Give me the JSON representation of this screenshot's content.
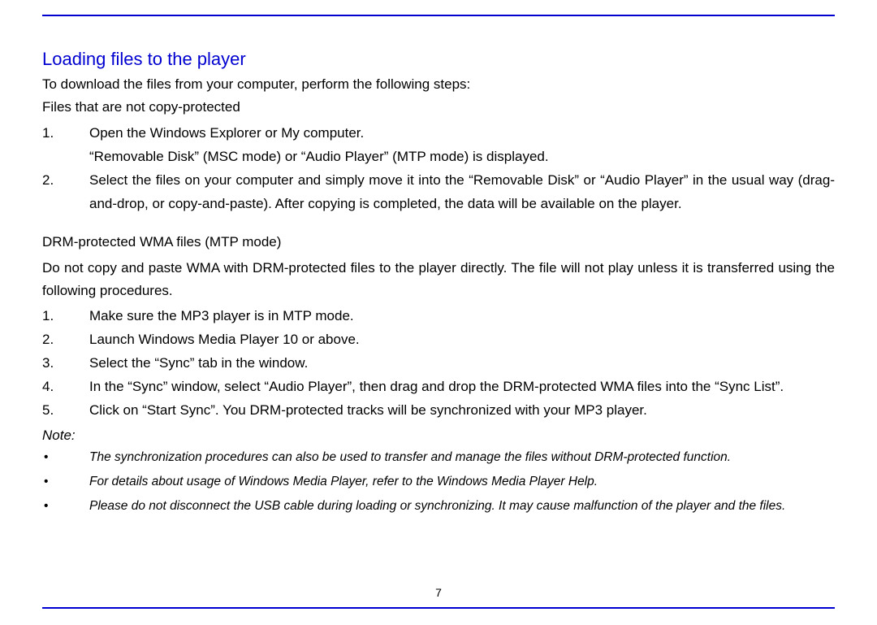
{
  "heading": "Loading files to the player",
  "intro": "To download the files from your computer, perform the following steps:",
  "sectionA": {
    "title": "Files that are not copy-protected",
    "items": [
      {
        "num": "1.",
        "text": "Open the Windows Explorer or My computer."
      },
      {
        "num": "",
        "text": "“Removable Disk” (MSC mode) or “Audio Player” (MTP mode) is displayed."
      },
      {
        "num": "2.",
        "text": "Select the files on your computer and simply move it into the “Removable Disk” or “Audio Player” in the usual way (drag-and-drop, or copy-and-paste). After copying is completed, the data will be available on the player."
      }
    ]
  },
  "sectionB": {
    "title": "DRM-protected WMA files (MTP mode)",
    "para": "Do not copy and paste WMA with DRM-protected files to the player directly. The file will not play unless it is transferred using the following procedures.",
    "items": [
      {
        "num": "1.",
        "text": "Make sure the MP3 player is in MTP mode."
      },
      {
        "num": "2.",
        "text": "Launch Windows Media Player 10 or above."
      },
      {
        "num": "3.",
        "text": "Select the “Sync” tab in the window."
      },
      {
        "num": "4.",
        "text": "In the “Sync” window, select “Audio Player”, then drag and drop the DRM-protected WMA files into the “Sync List”."
      },
      {
        "num": "5.",
        "text": "Click on “Start Sync”. You DRM-protected tracks will be synchronized with your MP3 player."
      }
    ]
  },
  "noteLabel": "Note:",
  "notes": [
    "The synchronization procedures can also be used to transfer and manage the files without DRM-protected function.",
    "For details about usage of Windows Media Player, refer to the Windows Media Player Help.",
    "Please do not disconnect the USB cable during loading or synchronizing. It may cause malfunction of the player and the files."
  ],
  "pageNumber": "7",
  "bullet": "•"
}
